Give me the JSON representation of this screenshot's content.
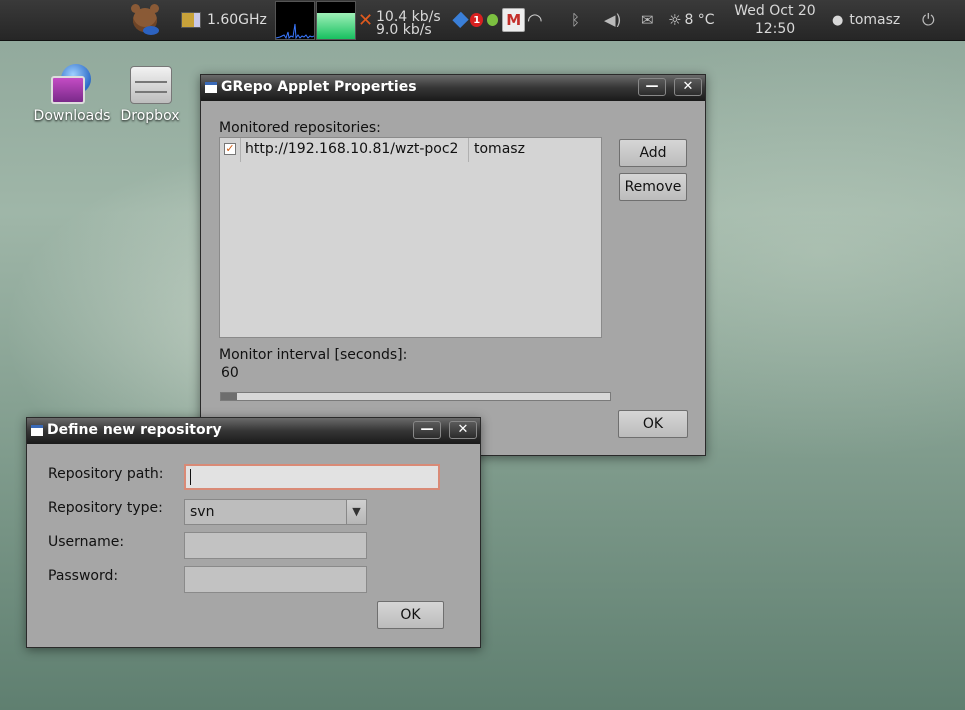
{
  "panel": {
    "cpu_freq": "1.60GHz",
    "net_up": "10.4 kb/s",
    "net_down": "9.0 kb/s",
    "notify_count": "1",
    "gmail_label": "M",
    "weather_temp": "8 °C",
    "clock_date": "Wed Oct 20",
    "clock_time": "12:50",
    "user": "tomasz"
  },
  "desktop": {
    "icons": [
      {
        "label": "Downloads"
      },
      {
        "label": "Dropbox"
      }
    ]
  },
  "props_window": {
    "title": "GRepo Applet Properties",
    "monitored_label": "Monitored repositories:",
    "repos": [
      {
        "checked": true,
        "url": "http://192.168.10.81/wzt-poc2",
        "user": "tomasz"
      }
    ],
    "add_button": "Add",
    "remove_button": "Remove",
    "interval_label": "Monitor interval [seconds]:",
    "interval_value": "60",
    "interval_fraction": 0.04,
    "ok_button": "OK"
  },
  "define_window": {
    "title": "Define new repository",
    "path_label": "Repository path:",
    "path_value": "",
    "type_label": "Repository type:",
    "type_value": "svn",
    "username_label": "Username:",
    "username_value": "",
    "password_label": "Password:",
    "password_value": "",
    "ok_button": "OK"
  },
  "window_buttons": {
    "minimize": "—",
    "close": "✕"
  }
}
